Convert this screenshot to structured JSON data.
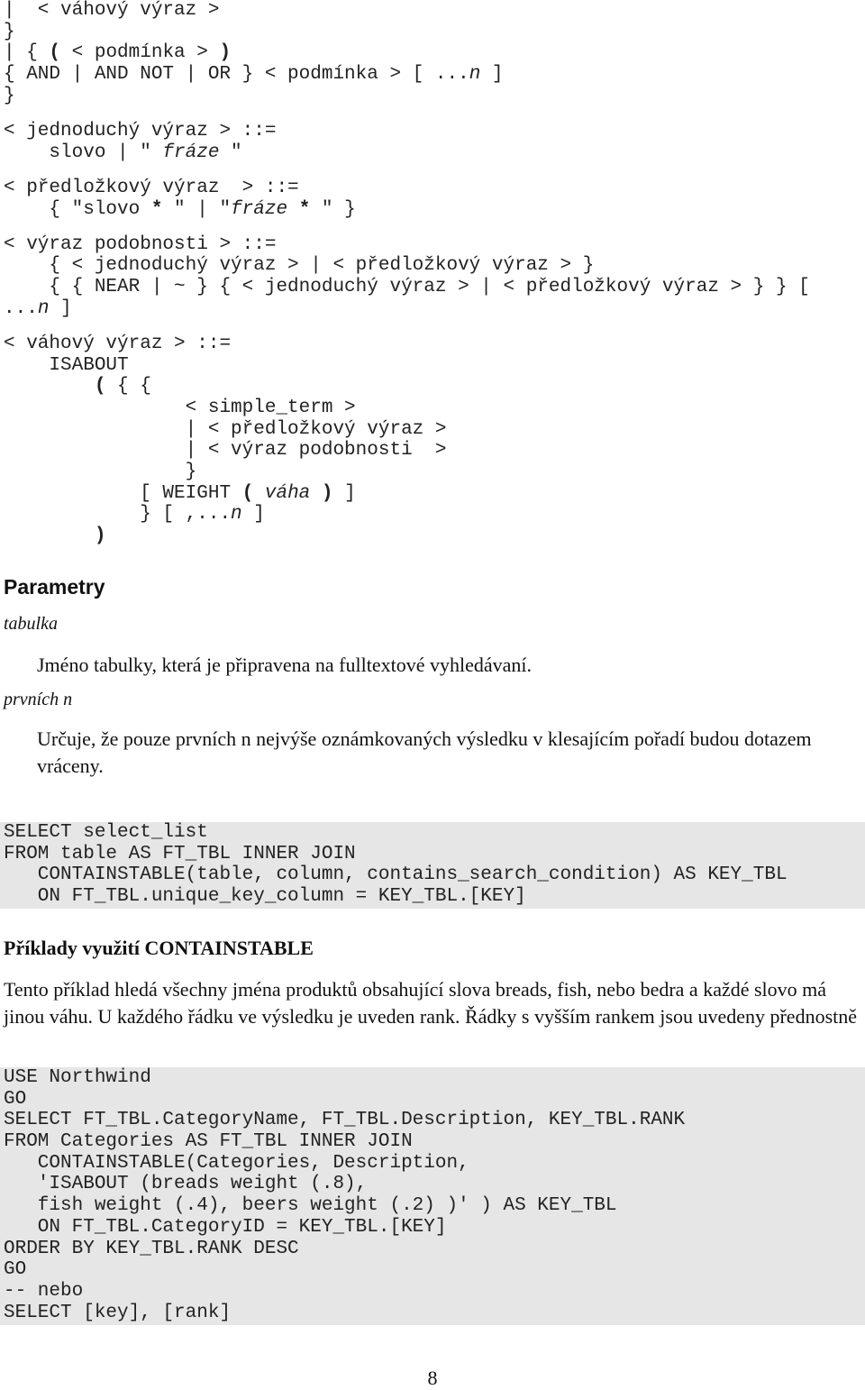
{
  "syntax_lines": [
    [
      [
        "|  < váhový výraz >",
        ""
      ]
    ],
    [
      [
        "}",
        ""
      ]
    ],
    [
      [
        "| { ",
        ""
      ],
      [
        "(",
        "b"
      ],
      [
        " < podmínka > ",
        ""
      ],
      [
        ")",
        "b"
      ]
    ],
    [
      [
        "{ AND | AND NOT | OR } < podmínka > [ ...",
        ""
      ],
      [
        "n",
        "i"
      ],
      [
        " ]",
        ""
      ]
    ],
    [
      [
        "}",
        ""
      ]
    ],
    null,
    [
      [
        "< jednoduchý výraz > ::=",
        ""
      ]
    ],
    [
      [
        "    slovo | \" ",
        ""
      ],
      [
        "fráze",
        "i"
      ],
      [
        " \"",
        ""
      ]
    ],
    null,
    [
      [
        "< předložkový výraz  > ::=",
        ""
      ]
    ],
    [
      [
        "    { \"slovo ",
        ""
      ],
      [
        "*",
        "b"
      ],
      [
        " \" | \"",
        ""
      ],
      [
        "fráze",
        "i"
      ],
      [
        " ",
        ""
      ],
      [
        "*",
        "b"
      ],
      [
        " \" }",
        ""
      ]
    ],
    null,
    [
      [
        "< výraz podobnosti > ::=",
        ""
      ]
    ],
    [
      [
        "    { < jednoduchý výraz > | < předložkový výraz > }",
        ""
      ]
    ],
    [
      [
        "    { { NEAR | ~ } { < jednoduchý výraz > | < předložkový výraz > } } [",
        ""
      ]
    ],
    [
      [
        "...",
        ""
      ],
      [
        "n",
        "i"
      ],
      [
        " ]",
        ""
      ]
    ],
    null,
    [
      [
        "< váhový výraz > ::=",
        ""
      ]
    ],
    [
      [
        "    ISABOUT",
        ""
      ]
    ],
    [
      [
        "        ",
        ""
      ],
      [
        "(",
        "b"
      ],
      [
        " { {",
        ""
      ]
    ],
    [
      [
        "                < simple_term >",
        ""
      ]
    ],
    [
      [
        "                | < předložkový výraz >",
        ""
      ]
    ],
    [
      [
        "                | < výraz podobnosti  >",
        ""
      ]
    ],
    [
      [
        "                }",
        ""
      ]
    ],
    [
      [
        "            [ WEIGHT ",
        ""
      ],
      [
        "(",
        "b"
      ],
      [
        " ",
        ""
      ],
      [
        "váha",
        "i"
      ],
      [
        " ",
        ""
      ],
      [
        ")",
        "b"
      ],
      [
        " ]",
        ""
      ]
    ],
    [
      [
        "            } [ ,...",
        ""
      ],
      [
        "n",
        "i"
      ],
      [
        " ]",
        ""
      ]
    ],
    [
      [
        "        ",
        ""
      ],
      [
        ")",
        "b"
      ]
    ]
  ],
  "parameters": {
    "heading": "Parametry",
    "items": [
      {
        "term": "tabulka",
        "description": "Jméno tabulky, která je připravena na fulltextové vyhledávaní."
      },
      {
        "term": "prvních n",
        "description": "Určuje, že pouze prvních n nejvýše oznámkovaných výsledku v klesajícím pořadí budou dotazem vráceny."
      }
    ]
  },
  "code_block_1": [
    "SELECT select_list",
    "FROM table AS FT_TBL INNER JOIN",
    "   CONTAINSTABLE(table, column, contains_search_condition) AS KEY_TBL",
    "   ON FT_TBL.unique_key_column = KEY_TBL.[KEY]"
  ],
  "examples": {
    "heading": "Příklady využití CONTAINSTABLE",
    "paragraph": "Tento příklad hledá všechny jména produktů obsahující slova breads, fish, nebo bedra a každé slovo má jinou váhu. U každého řádku ve výsledku je uveden rank. Řádky s vyšším rankem jsou uvedeny přednostně"
  },
  "code_block_2": [
    "USE Northwind",
    "GO",
    "SELECT FT_TBL.CategoryName, FT_TBL.Description, KEY_TBL.RANK",
    "FROM Categories AS FT_TBL INNER JOIN",
    "   CONTAINSTABLE(Categories, Description,",
    "   'ISABOUT (breads weight (.8),",
    "   fish weight (.4), beers weight (.2) )' ) AS KEY_TBL",
    "   ON FT_TBL.CategoryID = KEY_TBL.[KEY]",
    "ORDER BY KEY_TBL.RANK DESC",
    "GO",
    "-- nebo",
    "SELECT [key], [rank]"
  ],
  "page_number": "8"
}
